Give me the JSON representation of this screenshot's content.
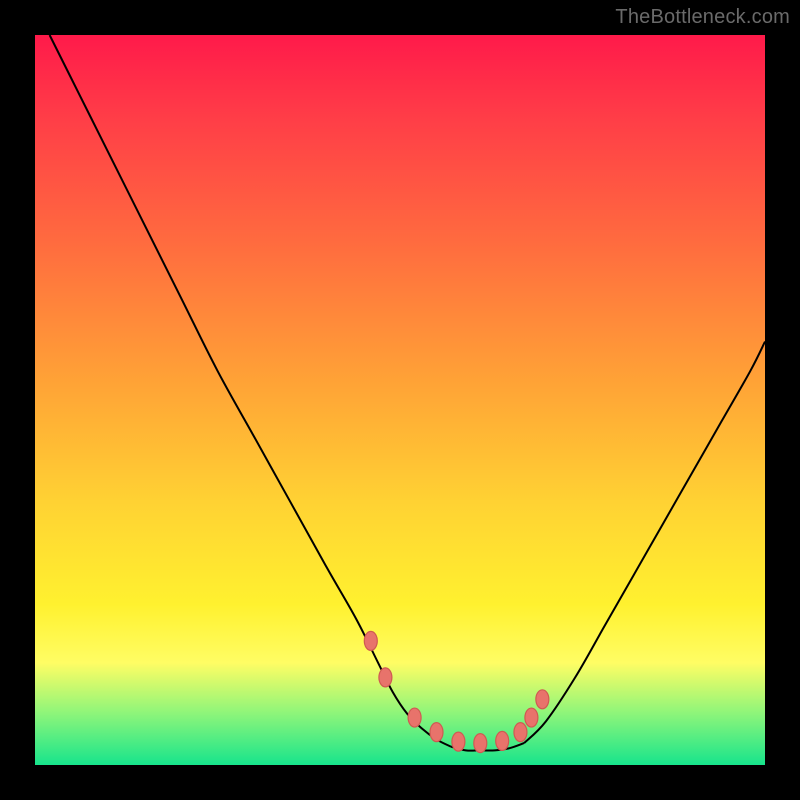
{
  "watermark": "TheBottleneck.com",
  "colors": {
    "frame": "#000000",
    "curve": "#000000",
    "dot_fill": "#e8736b",
    "dot_stroke": "#cf5a52",
    "gradient_stops": [
      "#ff1a4a",
      "#ff3f47",
      "#ff6a3f",
      "#ffa436",
      "#ffd233",
      "#fff12f",
      "#fffd64",
      "#8cf57a",
      "#17e48c"
    ]
  },
  "chart_data": {
    "type": "line",
    "title": "",
    "xlabel": "",
    "ylabel": "",
    "xlim": [
      0,
      100
    ],
    "ylim": [
      0,
      100
    ],
    "grid": false,
    "series": [
      {
        "name": "left-branch",
        "x": [
          2,
          6,
          10,
          15,
          20,
          25,
          30,
          35,
          40,
          44,
          47,
          49,
          51,
          53,
          55,
          57
        ],
        "y": [
          100,
          92,
          84,
          74,
          64,
          54,
          45,
          36,
          27,
          20,
          14,
          10,
          7,
          5,
          3.5,
          2.5
        ]
      },
      {
        "name": "valley",
        "x": [
          57,
          59,
          61,
          63,
          65,
          67
        ],
        "y": [
          2.5,
          2,
          2,
          2,
          2.3,
          3
        ]
      },
      {
        "name": "right-branch",
        "x": [
          67,
          70,
          74,
          78,
          82,
          86,
          90,
          94,
          98,
          100
        ],
        "y": [
          3,
          6,
          12,
          19,
          26,
          33,
          40,
          47,
          54,
          58
        ]
      }
    ],
    "markers": {
      "name": "highlighted-points",
      "x": [
        46,
        48,
        52,
        55,
        58,
        61,
        64,
        66.5,
        68,
        69.5
      ],
      "y": [
        17,
        12,
        6.5,
        4.5,
        3.2,
        3,
        3.3,
        4.5,
        6.5,
        9
      ]
    }
  }
}
